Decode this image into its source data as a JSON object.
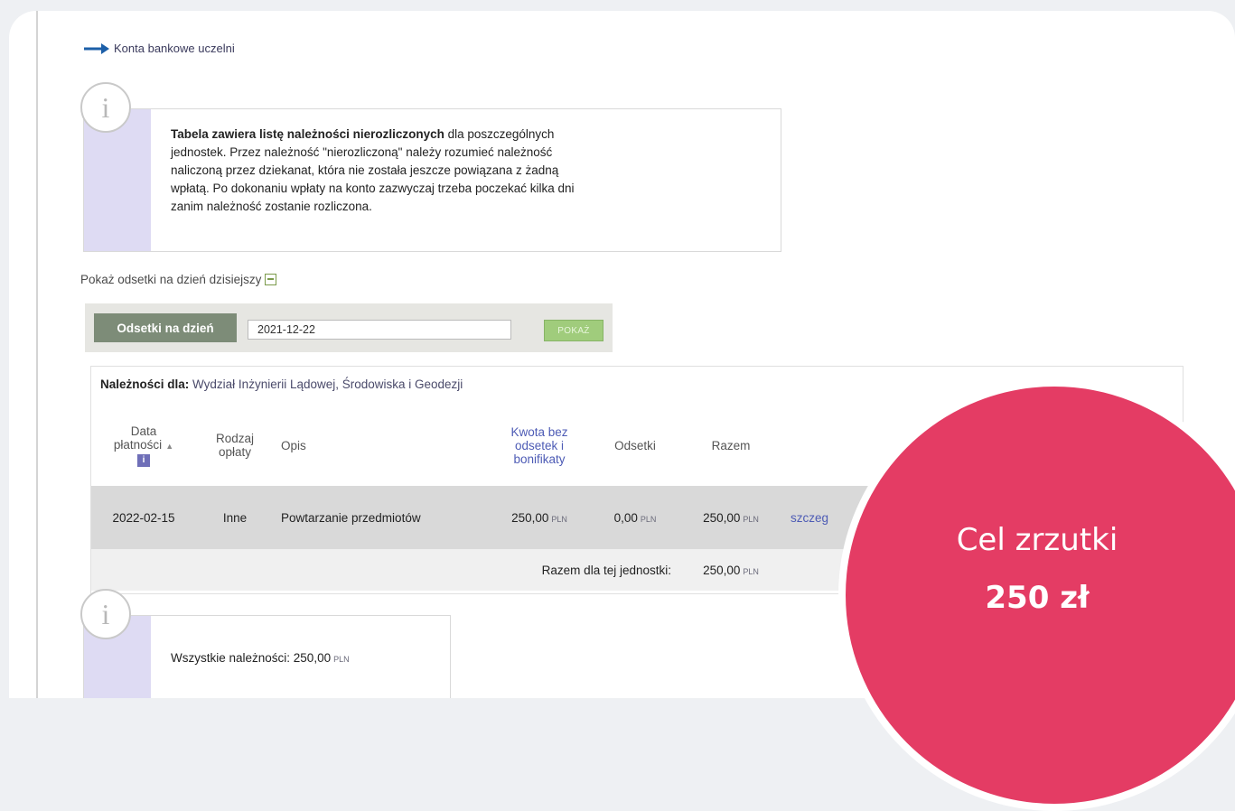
{
  "nav": {
    "bank_accounts_link": "Konta bankowe uczelni"
  },
  "info1": {
    "bold": "Tabela zawiera listę należności nierozliczonych",
    "rest_line1": " dla poszczególnych",
    "line2": "jednostek. Przez należność \"nierozliczoną\" należy rozumieć należność",
    "line3": "naliczoną przez dziekanat, która nie została jeszcze powiązana z żadną",
    "line4": "wpłatą. Po dokonaniu wpłaty na konto zazwyczaj trzeba poczekać kilka dni",
    "line5": "zanim należność zostanie rozliczona."
  },
  "interest": {
    "show_link": "Pokaż odsetki na dzień dzisiejszy",
    "label": "Odsetki na dzień",
    "date_value": "2021-12-22",
    "button": "POKAŻ"
  },
  "dues": {
    "caption_label": "Należności dla:",
    "caption_unit": "Wydział Inżynierii Lądowej, Środowiska i Geodezji",
    "headers": {
      "date_l1": "Data",
      "date_l2": "płatności",
      "sort": "▲",
      "info": "i",
      "type_l1": "Rodzaj",
      "type_l2": "opłaty",
      "desc": "Opis",
      "amount_l1": "Kwota bez",
      "amount_l2": "odsetek i",
      "amount_l3": "bonifikaty",
      "interest": "Odsetki",
      "total": "Razem"
    },
    "row": {
      "date": "2022-02-15",
      "type": "Inne",
      "desc": "Powtarzanie przedmiotów",
      "amount": "250,00",
      "interest": "0,00",
      "total": "250,00",
      "detail": "szczeg"
    },
    "currency": "PLN",
    "sum_label": "Razem dla tej jednostki:",
    "sum_value": "250,00"
  },
  "info2": {
    "label": "Wszystkie należności: 250,00",
    "currency": "PLN"
  },
  "goal": {
    "title": "Cel zrzutki",
    "amount": "250 zł",
    "color": "#e43c64"
  },
  "colors": {
    "info_side": "#dedbf3",
    "filter_label": "#7d8c78",
    "button": "#a0cc7c",
    "link": "#4d5bb5"
  },
  "icons": [
    "arrow-right-icon",
    "info-icon",
    "external-link-icon",
    "sort-ascending-icon"
  ]
}
